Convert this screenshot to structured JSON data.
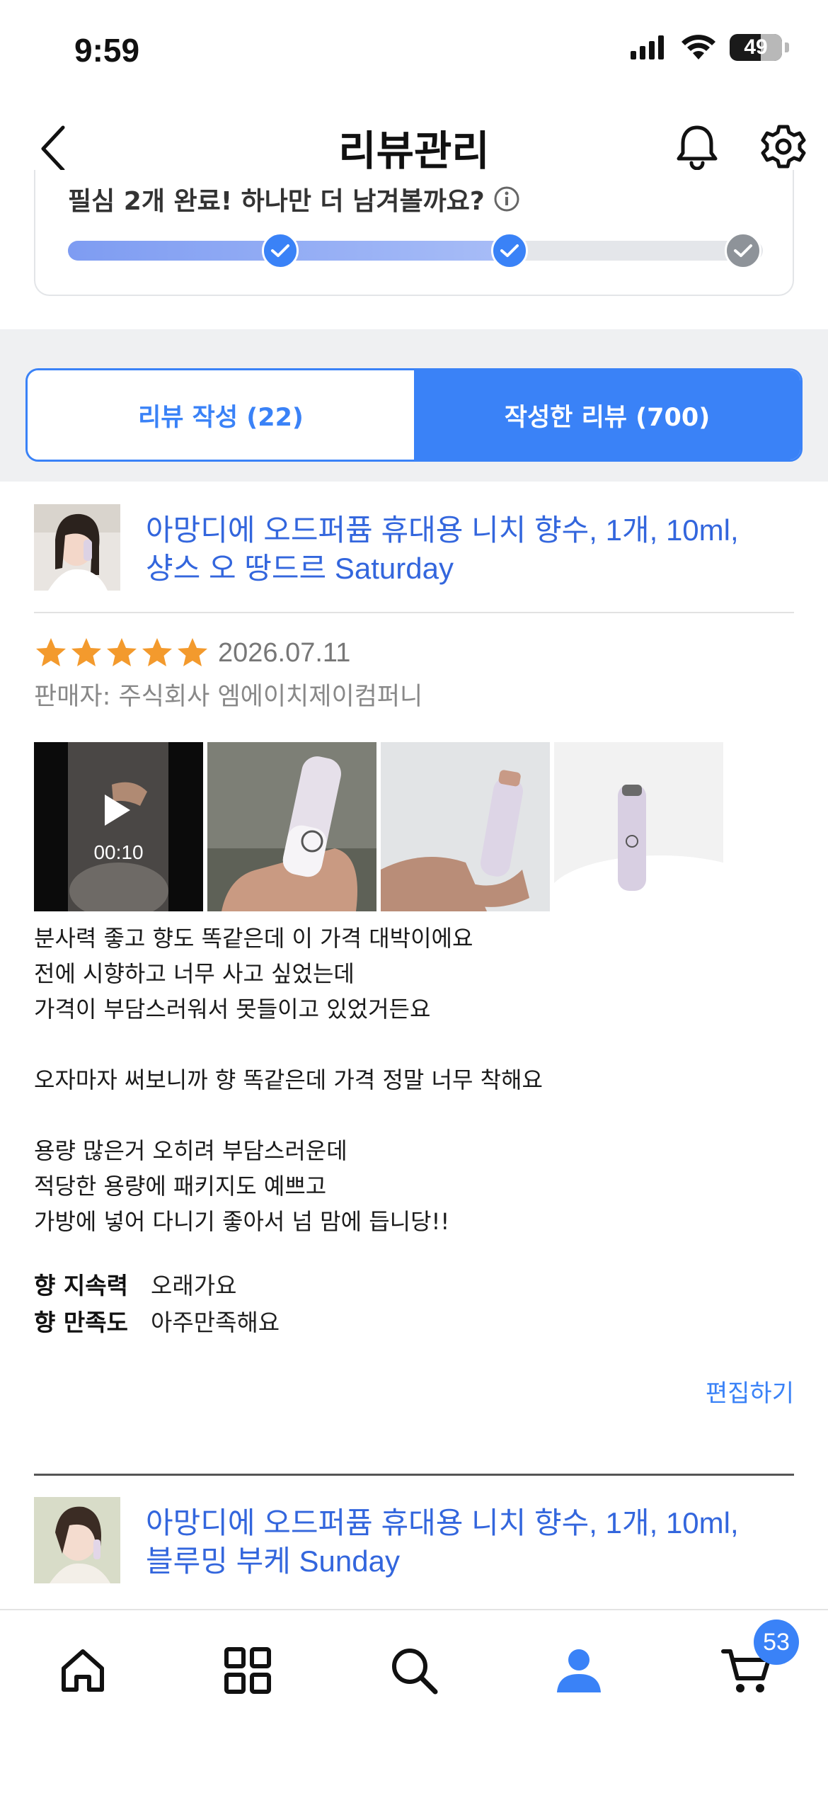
{
  "status_bar": {
    "time": "9:59",
    "battery": "49"
  },
  "nav": {
    "title": "리뷰관리"
  },
  "mission": {
    "text": "필심 2개 완료! 하나만 더 남겨볼까요?",
    "completed_steps": 2,
    "total_steps": 3
  },
  "tabs": [
    {
      "label": "리뷰 작성 (22)",
      "active": false
    },
    {
      "label": "작성한 리뷰 (700)",
      "active": true
    }
  ],
  "reviews": [
    {
      "product_title_line1": "아망디에 오드퍼퓸 휴대용 니치 향수, 1개, 10ml,",
      "product_title_line2": "샹스 오 땅드르 Saturday",
      "rating": 5,
      "date": "2026.07.11",
      "seller": "판매자: 주식회사 엠에이치제이컴퍼니",
      "video_duration": "00:10",
      "body": [
        "분사력 좋고 향도 똑같은데 이 가격 대박이에요",
        "전에 시향하고 너무 사고 싶었는데",
        "가격이 부담스러워서 못들이고 있었거든요",
        "",
        "오자마자 써보니까 향 똑같은데 가격 정말 너무 착해요",
        "",
        "용량 많은거 오히려 부담스러운데",
        "적당한 용량에 패키지도 예쁘고",
        "가방에 넣어 다니기 좋아서 넘 맘에 듭니당!!"
      ],
      "attributes": [
        {
          "label": "향 지속력",
          "value": "오래가요"
        },
        {
          "label": "향 만족도",
          "value": "아주만족해요"
        }
      ],
      "edit_label": "편집하기"
    },
    {
      "product_title_line1": "아망디에 오드퍼퓸 휴대용 니치 향수, 1개, 10ml,",
      "product_title_line2": "블루밍 부케 Sunday"
    }
  ],
  "tab_bar": {
    "items": [
      "home-icon",
      "category-grid-icon",
      "search-icon",
      "user-icon",
      "cart-icon"
    ],
    "cart_badge": "53"
  },
  "colors": {
    "accent": "#3a82f7",
    "link": "#3366dd",
    "star": "#f39a2d"
  }
}
